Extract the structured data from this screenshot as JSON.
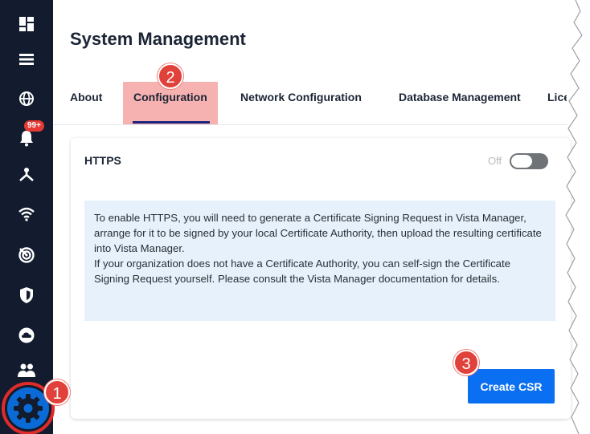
{
  "page": {
    "title": "System Management"
  },
  "nav": {
    "icons": [
      "dashboard-icon",
      "list-icon",
      "globe-icon",
      "bell-icon",
      "network-icon",
      "wifi-icon",
      "radar-icon",
      "shield-icon",
      "cloud-icon",
      "users-icon",
      "gear-icon"
    ],
    "notification_badge": "99+"
  },
  "tabs": [
    {
      "label": "About"
    },
    {
      "label": "Configuration"
    },
    {
      "label": "Network Configuration"
    },
    {
      "label": "Database Management"
    },
    {
      "label": "Lice"
    }
  ],
  "https": {
    "title": "HTTPS",
    "toggle_label": "Off",
    "toggle_on": false,
    "info_lines": [
      "To enable HTTPS, you will need to generate a Certificate Signing Request in Vista Manager, arrange for it to be signed by your local Certificate Authority, then upload the resulting certificate into Vista Manager.",
      "If your organization does not have a Certificate Authority, you can self-sign the Certificate Signing Request yourself. Please consult the Vista Manager documentation for details."
    ],
    "button_label": "Create CSR"
  },
  "callouts": [
    "1",
    "2",
    "3"
  ],
  "colors": {
    "rail": "#121c2e",
    "accent": "#0a6ff1",
    "callout": "#e0413a",
    "info_bg": "#e6f1fb"
  }
}
